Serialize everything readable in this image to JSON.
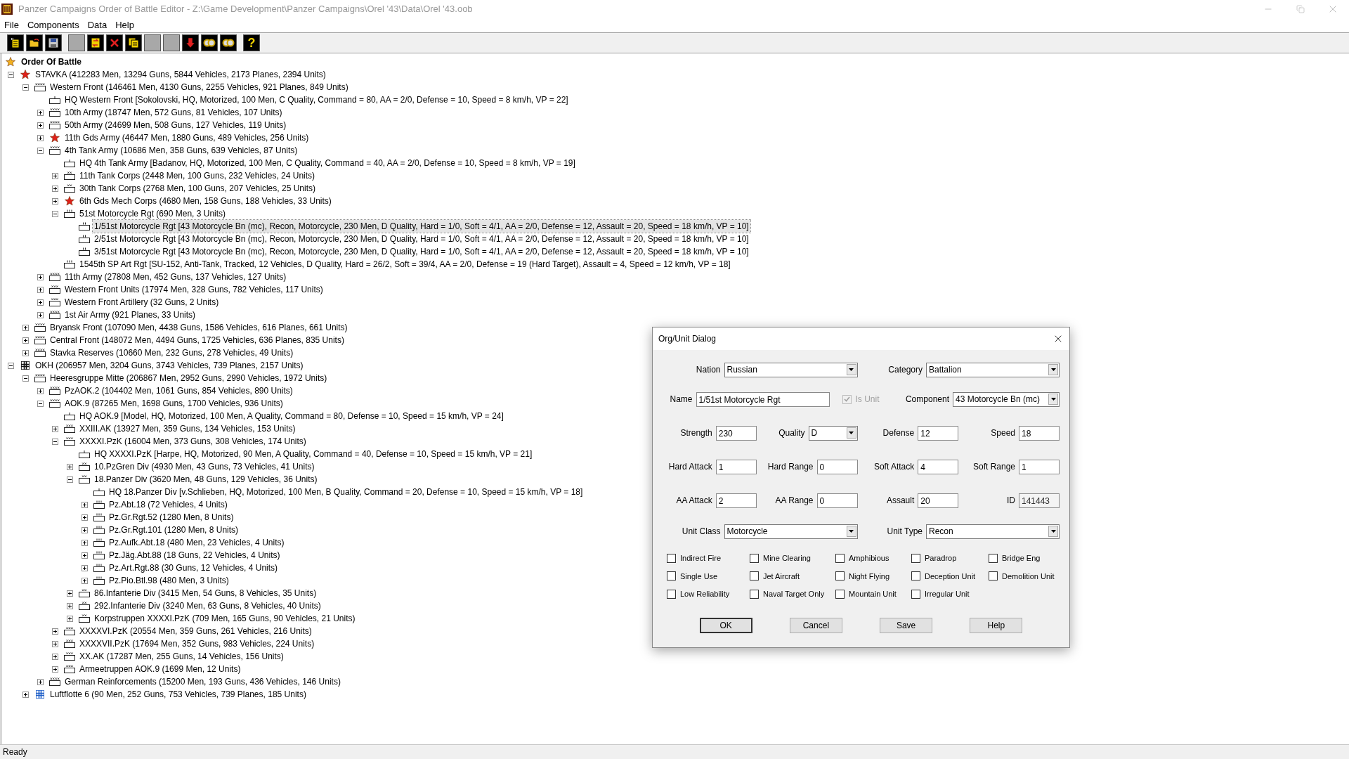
{
  "window": {
    "title": "Panzer Campaigns Order of Battle Editor - Z:\\Game Development\\Panzer Campaigns\\Orel '43\\Data\\Orel '43.oob"
  },
  "menu": [
    "File",
    "Components",
    "Data",
    "Help"
  ],
  "toolbar": [
    {
      "kind": "new",
      "disabled": false
    },
    {
      "kind": "open",
      "disabled": false
    },
    {
      "kind": "save",
      "disabled": false
    },
    {
      "kind": "blank",
      "disabled": true
    },
    {
      "kind": "swap",
      "disabled": false
    },
    {
      "kind": "delete",
      "disabled": false
    },
    {
      "kind": "copy",
      "disabled": false
    },
    {
      "kind": "blank",
      "disabled": true
    },
    {
      "kind": "blank",
      "disabled": true
    },
    {
      "kind": "down",
      "disabled": false
    },
    {
      "kind": "link",
      "disabled": false
    },
    {
      "kind": "link",
      "disabled": false
    },
    {
      "kind": "help",
      "disabled": false,
      "label": "?"
    }
  ],
  "tree": {
    "label": "Order Of Battle",
    "kind": "star_gold",
    "children": [
      {
        "label": "STAVKA (412283 Men, 13294 Guns, 5844 Vehicles, 2173 Planes, 2394 Units)",
        "kind": "star_red",
        "expanded": true,
        "selected": false,
        "children": [
          {
            "label": "Western Front (146461 Men, 4130 Guns, 2255 Vehicles, 921 Planes, 849 Units)",
            "kind": "xxxx",
            "expanded": true,
            "selected": false,
            "children": [
              {
                "label": "HQ Western Front [Sokolovski, HQ, Motorized, 100 Men, C Quality, Command = 80, AA = 2/0, Defense = 10, Speed = 8 km/h, VP = 22]",
                "kind": "hq",
                "selected": false
              },
              {
                "label": "10th Army (18747 Men, 572 Guns, 81 Vehicles, 107 Units)",
                "kind": "xxxx",
                "expanded": false,
                "selected": false
              },
              {
                "label": "50th Army (24699 Men, 508 Guns, 127 Vehicles, 119 Units)",
                "kind": "xxxx",
                "expanded": false,
                "selected": false
              },
              {
                "label": "11th Gds Army (46447 Men, 1880 Guns, 489 Vehicles, 256 Units)",
                "kind": "star_red",
                "expanded": false,
                "selected": false
              },
              {
                "label": "4th Tank Army (10686 Men, 358 Guns, 639 Vehicles, 87 Units)",
                "kind": "xxxx",
                "expanded": true,
                "selected": false,
                "children": [
                  {
                    "label": "HQ 4th Tank Army [Badanov, HQ, Motorized, 100 Men, C Quality, Command = 40, AA = 2/0, Defense = 10, Speed = 8 km/h, VP = 19]",
                    "kind": "hq",
                    "selected": false
                  },
                  {
                    "label": "11th Tank Corps (2448 Men, 100 Guns, 232 Vehicles, 24 Units)",
                    "kind": "xx",
                    "expanded": false,
                    "selected": false
                  },
                  {
                    "label": "30th Tank Corps (2768 Men, 100 Guns, 207 Vehicles, 25 Units)",
                    "kind": "xx",
                    "expanded": false,
                    "selected": false
                  },
                  {
                    "label": "6th Gds Mech Corps (4680 Men, 158 Guns, 188 Vehicles, 33 Units)",
                    "kind": "star_red",
                    "expanded": false,
                    "selected": false
                  },
                  {
                    "label": "51st Motorcycle Rgt (690 Men, 3 Units)",
                    "kind": "iii",
                    "expanded": true,
                    "selected": false,
                    "children": [
                      {
                        "label": "1/51st Motorcycle Rgt [43 Motorcycle Bn (mc), Recon, Motorcycle, 230 Men, D Quality, Hard = 1/0, Soft = 4/1, AA = 2/0, Defense = 12, Assault = 20, Speed = 18 km/h, VP = 10]",
                        "kind": "ii",
                        "selected": true
                      },
                      {
                        "label": "2/51st Motorcycle Rgt [43 Motorcycle Bn (mc), Recon, Motorcycle, 230 Men, D Quality, Hard = 1/0, Soft = 4/1, AA = 2/0, Defense = 12, Assault = 20, Speed = 18 km/h, VP = 10]",
                        "kind": "ii",
                        "selected": false
                      },
                      {
                        "label": "3/51st Motorcycle Rgt [43 Motorcycle Bn (mc), Recon, Motorcycle, 230 Men, D Quality, Hard = 1/0, Soft = 4/1, AA = 2/0, Defense = 12, Assault = 20, Speed = 18 km/h, VP = 10]",
                        "kind": "ii",
                        "selected": false
                      }
                    ]
                  },
                  {
                    "label": "1545th SP Art Rgt [SU-152, Anti-Tank, Tracked, 12 Vehicles, D Quality, Hard = 26/2, Soft = 39/4, AA = 2/0, Defense = 19 (Hard Target), Assault = 4, Speed = 12 km/h, VP = 18]",
                    "kind": "iii",
                    "selected": false
                  }
                ]
              },
              {
                "label": "11th Army (27808 Men, 452 Guns, 137 Vehicles, 127 Units)",
                "kind": "xxxx",
                "expanded": false,
                "selected": false
              },
              {
                "label": "Western Front Units (17974 Men, 328 Guns, 782 Vehicles, 117 Units)",
                "kind": "xxx",
                "expanded": false,
                "selected": false
              },
              {
                "label": "Western Front Artillery (32 Guns, 2 Units)",
                "kind": "xxx",
                "expanded": false,
                "selected": false
              },
              {
                "label": "1st Air Army (921 Planes, 33 Units)",
                "kind": "xxxx",
                "expanded": false,
                "selected": false
              }
            ]
          },
          {
            "label": "Bryansk Front (107090 Men, 4438 Guns, 1586 Vehicles, 616 Planes, 661 Units)",
            "kind": "xxxx",
            "expanded": false,
            "selected": false
          },
          {
            "label": "Central Front (148072 Men, 4494 Guns, 1725 Vehicles, 636 Planes, 835 Units)",
            "kind": "xxxx",
            "expanded": false,
            "selected": false
          },
          {
            "label": "Stavka Reserves (10660 Men, 232 Guns, 278 Vehicles, 49 Units)",
            "kind": "xxxx",
            "expanded": false,
            "selected": false
          }
        ]
      },
      {
        "label": "OKH (206957 Men, 3204 Guns, 3743 Vehicles, 739 Planes, 2157 Units)",
        "kind": "cross",
        "expanded": true,
        "selected": false,
        "children": [
          {
            "label": "Heeresgruppe Mitte (206867 Men, 2952 Guns, 2990 Vehicles, 1972 Units)",
            "kind": "xxxx",
            "expanded": true,
            "selected": false,
            "children": [
              {
                "label": "PzAOK.2 (104402 Men, 1061 Guns, 854 Vehicles, 890 Units)",
                "kind": "xxxx",
                "expanded": false,
                "selected": false
              },
              {
                "label": "AOK.9 (87265 Men, 1698 Guns, 1700 Vehicles, 936 Units)",
                "kind": "xxxx",
                "expanded": true,
                "selected": false,
                "children": [
                  {
                    "label": "HQ AOK.9 [Model, HQ, Motorized, 100 Men, A Quality, Command = 80, Defense = 10, Speed = 15 km/h, VP = 24]",
                    "kind": "hq",
                    "selected": false
                  },
                  {
                    "label": "XXIII.AK (13927 Men, 359 Guns, 134 Vehicles, 153 Units)",
                    "kind": "xxx",
                    "expanded": false,
                    "selected": false
                  },
                  {
                    "label": "XXXXI.PzK (16004 Men, 373 Guns, 308 Vehicles, 174 Units)",
                    "kind": "xxx",
                    "expanded": true,
                    "selected": false,
                    "children": [
                      {
                        "label": "HQ XXXXI.PzK [Harpe, HQ, Motorized, 90 Men, A Quality, Command = 40, Defense = 10, Speed = 15 km/h, VP = 21]",
                        "kind": "hq",
                        "selected": false
                      },
                      {
                        "label": "10.PzGren Div (4930 Men, 43 Guns, 73 Vehicles, 41 Units)",
                        "kind": "xx",
                        "expanded": false,
                        "selected": false
                      },
                      {
                        "label": "18.Panzer Div (3620 Men, 48 Guns, 129 Vehicles, 36 Units)",
                        "kind": "xx",
                        "expanded": true,
                        "selected": false,
                        "children": [
                          {
                            "label": "HQ 18.Panzer Div [v.Schlieben, HQ, Motorized, 100 Men, B Quality, Command = 20, Defense = 10, Speed = 15 km/h, VP = 18]",
                            "kind": "hq",
                            "selected": false
                          },
                          {
                            "label": "Pz.Abt.18 (72 Vehicles, 4 Units)",
                            "kind": "iii",
                            "expanded": false,
                            "selected": false
                          },
                          {
                            "label": "Pz.Gr.Rgt.52 (1280 Men, 8 Units)",
                            "kind": "iii",
                            "expanded": false,
                            "selected": false
                          },
                          {
                            "label": "Pz.Gr.Rgt.101 (1280 Men, 8 Units)",
                            "kind": "iii",
                            "expanded": false,
                            "selected": false
                          },
                          {
                            "label": "Pz.Aufk.Abt.18 (480 Men, 23 Vehicles, 4 Units)",
                            "kind": "iii",
                            "expanded": false,
                            "selected": false
                          },
                          {
                            "label": "Pz.Jäg.Abt.88 (18 Guns, 22 Vehicles, 4 Units)",
                            "kind": "iii",
                            "expanded": false,
                            "selected": false
                          },
                          {
                            "label": "Pz.Art.Rgt.88 (30 Guns, 12 Vehicles, 4 Units)",
                            "kind": "iii",
                            "expanded": false,
                            "selected": false
                          },
                          {
                            "label": "Pz.Pio.Btl.98 (480 Men, 3 Units)",
                            "kind": "iii",
                            "expanded": false,
                            "selected": false
                          }
                        ]
                      },
                      {
                        "label": "86.Infanterie Div (3415 Men, 54 Guns, 8 Vehicles, 35 Units)",
                        "kind": "xx",
                        "expanded": false,
                        "selected": false
                      },
                      {
                        "label": "292.Infanterie Div (3240 Men, 63 Guns, 8 Vehicles, 40 Units)",
                        "kind": "xx",
                        "expanded": false,
                        "selected": false
                      },
                      {
                        "label": "Korpstruppen XXXXI.PzK (709 Men, 165 Guns, 90 Vehicles, 21 Units)",
                        "kind": "xx",
                        "expanded": false,
                        "selected": false
                      }
                    ]
                  },
                  {
                    "label": "XXXXVI.PzK (20554 Men, 359 Guns, 261 Vehicles, 216 Units)",
                    "kind": "xxx",
                    "expanded": false,
                    "selected": false
                  },
                  {
                    "label": "XXXXVII.PzK (17694 Men, 352 Guns, 983 Vehicles, 224 Units)",
                    "kind": "xxx",
                    "expanded": false,
                    "selected": false
                  },
                  {
                    "label": "XX.AK (17287 Men, 255 Guns, 14 Vehicles, 156 Units)",
                    "kind": "xxx",
                    "expanded": false,
                    "selected": false
                  },
                  {
                    "label": "Armeetruppen AOK.9 (1699 Men, 12 Units)",
                    "kind": "xxx",
                    "expanded": false,
                    "selected": false
                  }
                ]
              },
              {
                "label": "German Reinforcements (15200 Men, 193 Guns, 436 Vehicles, 146 Units)",
                "kind": "xxxx",
                "expanded": false,
                "selected": false
              }
            ]
          },
          {
            "label": "Luftflotte 6 (90 Men, 252 Guns, 753 Vehicles, 739 Planes, 185 Units)",
            "kind": "air",
            "expanded": false,
            "selected": false
          }
        ]
      }
    ]
  },
  "dialog": {
    "title": "Org/Unit Dialog",
    "rows": [
      [
        {
          "kind": "combo",
          "label": "Nation",
          "value": "Russian"
        },
        {
          "kind": "combo",
          "label": "Category",
          "value": "Battalion"
        }
      ],
      [
        {
          "kind": "text",
          "label": "Name",
          "value": "1/51st Motorcycle Rgt"
        },
        {
          "kind": "check",
          "label": "Is Unit",
          "checked": true,
          "disabled": true
        },
        {
          "kind": "combo",
          "label": "Component",
          "value": "43 Motorcycle Bn (mc)"
        }
      ],
      [
        {
          "kind": "text",
          "label": "Strength",
          "value": "230"
        },
        {
          "kind": "combo",
          "label": "Quality",
          "value": "D"
        },
        {
          "kind": "text",
          "label": "Defense",
          "value": "12"
        },
        {
          "kind": "text",
          "label": "Speed",
          "value": "18"
        }
      ],
      [
        {
          "kind": "text",
          "label": "Hard Attack",
          "value": "1"
        },
        {
          "kind": "text",
          "label": "Hard Range",
          "value": "0"
        },
        {
          "kind": "text",
          "label": "Soft Attack",
          "value": "4"
        },
        {
          "kind": "text",
          "label": "Soft Range",
          "value": "1"
        }
      ],
      [
        {
          "kind": "text",
          "label": "AA Attack",
          "value": "2"
        },
        {
          "kind": "text",
          "label": "AA Range",
          "value": "0"
        },
        {
          "kind": "text",
          "label": "Assault",
          "value": "20"
        },
        {
          "kind": "text",
          "label": "ID",
          "value": "141443",
          "disabled": true
        }
      ],
      [
        {
          "kind": "combo",
          "label": "Unit Class",
          "value": "Motorcycle"
        },
        {
          "kind": "combo",
          "label": "Unit Type",
          "value": "Recon"
        }
      ]
    ],
    "flags": [
      {
        "label": "Indirect Fire",
        "checked": false
      },
      {
        "label": "Mine Clearing",
        "checked": false
      },
      {
        "label": "Amphibious",
        "checked": false
      },
      {
        "label": "Paradrop",
        "checked": false
      },
      {
        "label": "Bridge Eng",
        "checked": false
      },
      {
        "label": "Single Use",
        "checked": false
      },
      {
        "label": "Jet Aircraft",
        "checked": false
      },
      {
        "label": "Night Flying",
        "checked": false
      },
      {
        "label": "Deception Unit",
        "checked": false
      },
      {
        "label": "Demolition Unit",
        "checked": false
      },
      {
        "label": "Low Reliability",
        "checked": false
      },
      {
        "label": "Naval Target Only",
        "checked": false
      },
      {
        "label": "Mountain Unit",
        "checked": false
      },
      {
        "label": "Irregular Unit",
        "checked": false
      }
    ],
    "buttons": [
      {
        "label": "OK",
        "default": true
      },
      {
        "label": "Cancel",
        "default": false
      },
      {
        "label": "Save",
        "default": false
      },
      {
        "label": "Help",
        "default": false
      }
    ]
  },
  "status_bar": "Ready"
}
